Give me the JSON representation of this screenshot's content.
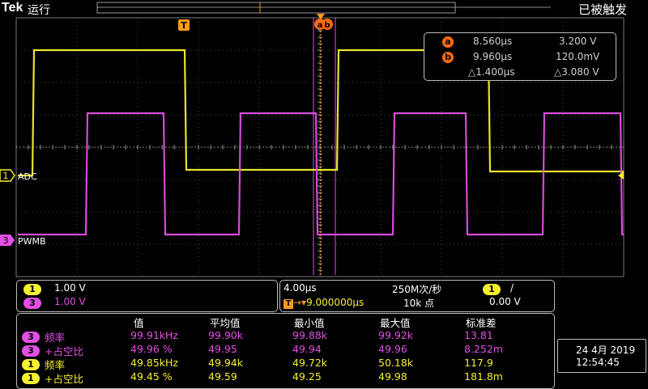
{
  "header": {
    "brand": "Tek",
    "run_state": "运行",
    "trigger_status": "已被触发"
  },
  "markers": {
    "trigger": "T",
    "cursor_a": "a",
    "cursor_b": "b"
  },
  "channels": [
    {
      "id": "1",
      "label": "ADC",
      "scale": "1.00 V",
      "color": "#f5f030"
    },
    {
      "id": "3",
      "label": "PWMB",
      "scale": "1.00 V",
      "color": "#e14fe4"
    }
  ],
  "cursors": {
    "a": {
      "time": "8.560µs",
      "value": "3.200 V"
    },
    "b": {
      "time": "9.960µs",
      "value": "120.0mV"
    },
    "delta": {
      "time": "△1.400µs",
      "value": "△3.080 V"
    }
  },
  "timebase": {
    "scale": "4.00µs",
    "sample_rate": "250M次/秒",
    "trigger_position": "9.000000µs",
    "record_length": "10k 点",
    "trigger_channel": "1",
    "trigger_slope": "/",
    "trigger_level": "0.00 V"
  },
  "measurements": {
    "headers": [
      "值",
      "平均值",
      "最小值",
      "最大值",
      "标准差"
    ],
    "rows": [
      {
        "ch": "3",
        "name": "频率",
        "value": "99.91kHz",
        "mean": "99.90k",
        "min": "99.88k",
        "max": "99.92k",
        "std": "13.81"
      },
      {
        "ch": "3",
        "name": "+占空比",
        "value": "49.96 %",
        "mean": "49.95",
        "min": "49.94",
        "max": "49.96",
        "std": "8.252m"
      },
      {
        "ch": "1",
        "name": "频率",
        "value": "49.85kHz",
        "mean": "49.94k",
        "min": "49.72k",
        "max": "50.18k",
        "std": "117.9"
      },
      {
        "ch": "1",
        "name": "+占空比",
        "value": "49.45 %",
        "mean": "49.59",
        "min": "49.25",
        "max": "49.98",
        "std": "181.8m"
      }
    ]
  },
  "datetime": {
    "date": "24 4月 2019",
    "time": "12:54:45"
  },
  "colors": {
    "yellow": "#f5f030",
    "magenta": "#e14fe4",
    "cursor": "#ff6a10",
    "trigger": "#ff9a1a",
    "grid": "#5a5a5a"
  }
}
